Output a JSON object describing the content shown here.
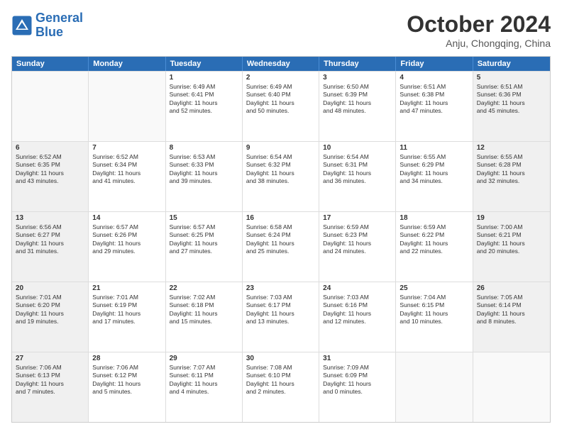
{
  "header": {
    "logo_line1": "General",
    "logo_line2": "Blue",
    "month": "October 2024",
    "location": "Anju, Chongqing, China"
  },
  "weekdays": [
    "Sunday",
    "Monday",
    "Tuesday",
    "Wednesday",
    "Thursday",
    "Friday",
    "Saturday"
  ],
  "rows": [
    [
      {
        "day": "",
        "empty": true
      },
      {
        "day": "",
        "empty": true
      },
      {
        "day": "1",
        "lines": [
          "Sunrise: 6:49 AM",
          "Sunset: 6:41 PM",
          "Daylight: 11 hours",
          "and 52 minutes."
        ]
      },
      {
        "day": "2",
        "lines": [
          "Sunrise: 6:49 AM",
          "Sunset: 6:40 PM",
          "Daylight: 11 hours",
          "and 50 minutes."
        ]
      },
      {
        "day": "3",
        "lines": [
          "Sunrise: 6:50 AM",
          "Sunset: 6:39 PM",
          "Daylight: 11 hours",
          "and 48 minutes."
        ]
      },
      {
        "day": "4",
        "lines": [
          "Sunrise: 6:51 AM",
          "Sunset: 6:38 PM",
          "Daylight: 11 hours",
          "and 47 minutes."
        ]
      },
      {
        "day": "5",
        "lines": [
          "Sunrise: 6:51 AM",
          "Sunset: 6:36 PM",
          "Daylight: 11 hours",
          "and 45 minutes."
        ]
      }
    ],
    [
      {
        "day": "6",
        "lines": [
          "Sunrise: 6:52 AM",
          "Sunset: 6:35 PM",
          "Daylight: 11 hours",
          "and 43 minutes."
        ]
      },
      {
        "day": "7",
        "lines": [
          "Sunrise: 6:52 AM",
          "Sunset: 6:34 PM",
          "Daylight: 11 hours",
          "and 41 minutes."
        ]
      },
      {
        "day": "8",
        "lines": [
          "Sunrise: 6:53 AM",
          "Sunset: 6:33 PM",
          "Daylight: 11 hours",
          "and 39 minutes."
        ]
      },
      {
        "day": "9",
        "lines": [
          "Sunrise: 6:54 AM",
          "Sunset: 6:32 PM",
          "Daylight: 11 hours",
          "and 38 minutes."
        ]
      },
      {
        "day": "10",
        "lines": [
          "Sunrise: 6:54 AM",
          "Sunset: 6:31 PM",
          "Daylight: 11 hours",
          "and 36 minutes."
        ]
      },
      {
        "day": "11",
        "lines": [
          "Sunrise: 6:55 AM",
          "Sunset: 6:29 PM",
          "Daylight: 11 hours",
          "and 34 minutes."
        ]
      },
      {
        "day": "12",
        "lines": [
          "Sunrise: 6:55 AM",
          "Sunset: 6:28 PM",
          "Daylight: 11 hours",
          "and 32 minutes."
        ]
      }
    ],
    [
      {
        "day": "13",
        "lines": [
          "Sunrise: 6:56 AM",
          "Sunset: 6:27 PM",
          "Daylight: 11 hours",
          "and 31 minutes."
        ]
      },
      {
        "day": "14",
        "lines": [
          "Sunrise: 6:57 AM",
          "Sunset: 6:26 PM",
          "Daylight: 11 hours",
          "and 29 minutes."
        ]
      },
      {
        "day": "15",
        "lines": [
          "Sunrise: 6:57 AM",
          "Sunset: 6:25 PM",
          "Daylight: 11 hours",
          "and 27 minutes."
        ]
      },
      {
        "day": "16",
        "lines": [
          "Sunrise: 6:58 AM",
          "Sunset: 6:24 PM",
          "Daylight: 11 hours",
          "and 25 minutes."
        ]
      },
      {
        "day": "17",
        "lines": [
          "Sunrise: 6:59 AM",
          "Sunset: 6:23 PM",
          "Daylight: 11 hours",
          "and 24 minutes."
        ]
      },
      {
        "day": "18",
        "lines": [
          "Sunrise: 6:59 AM",
          "Sunset: 6:22 PM",
          "Daylight: 11 hours",
          "and 22 minutes."
        ]
      },
      {
        "day": "19",
        "lines": [
          "Sunrise: 7:00 AM",
          "Sunset: 6:21 PM",
          "Daylight: 11 hours",
          "and 20 minutes."
        ]
      }
    ],
    [
      {
        "day": "20",
        "lines": [
          "Sunrise: 7:01 AM",
          "Sunset: 6:20 PM",
          "Daylight: 11 hours",
          "and 19 minutes."
        ]
      },
      {
        "day": "21",
        "lines": [
          "Sunrise: 7:01 AM",
          "Sunset: 6:19 PM",
          "Daylight: 11 hours",
          "and 17 minutes."
        ]
      },
      {
        "day": "22",
        "lines": [
          "Sunrise: 7:02 AM",
          "Sunset: 6:18 PM",
          "Daylight: 11 hours",
          "and 15 minutes."
        ]
      },
      {
        "day": "23",
        "lines": [
          "Sunrise: 7:03 AM",
          "Sunset: 6:17 PM",
          "Daylight: 11 hours",
          "and 13 minutes."
        ]
      },
      {
        "day": "24",
        "lines": [
          "Sunrise: 7:03 AM",
          "Sunset: 6:16 PM",
          "Daylight: 11 hours",
          "and 12 minutes."
        ]
      },
      {
        "day": "25",
        "lines": [
          "Sunrise: 7:04 AM",
          "Sunset: 6:15 PM",
          "Daylight: 11 hours",
          "and 10 minutes."
        ]
      },
      {
        "day": "26",
        "lines": [
          "Sunrise: 7:05 AM",
          "Sunset: 6:14 PM",
          "Daylight: 11 hours",
          "and 8 minutes."
        ]
      }
    ],
    [
      {
        "day": "27",
        "lines": [
          "Sunrise: 7:06 AM",
          "Sunset: 6:13 PM",
          "Daylight: 11 hours",
          "and 7 minutes."
        ]
      },
      {
        "day": "28",
        "lines": [
          "Sunrise: 7:06 AM",
          "Sunset: 6:12 PM",
          "Daylight: 11 hours",
          "and 5 minutes."
        ]
      },
      {
        "day": "29",
        "lines": [
          "Sunrise: 7:07 AM",
          "Sunset: 6:11 PM",
          "Daylight: 11 hours",
          "and 4 minutes."
        ]
      },
      {
        "day": "30",
        "lines": [
          "Sunrise: 7:08 AM",
          "Sunset: 6:10 PM",
          "Daylight: 11 hours",
          "and 2 minutes."
        ]
      },
      {
        "day": "31",
        "lines": [
          "Sunrise: 7:09 AM",
          "Sunset: 6:09 PM",
          "Daylight: 11 hours",
          "and 0 minutes."
        ]
      },
      {
        "day": "",
        "empty": true
      },
      {
        "day": "",
        "empty": true
      }
    ]
  ]
}
